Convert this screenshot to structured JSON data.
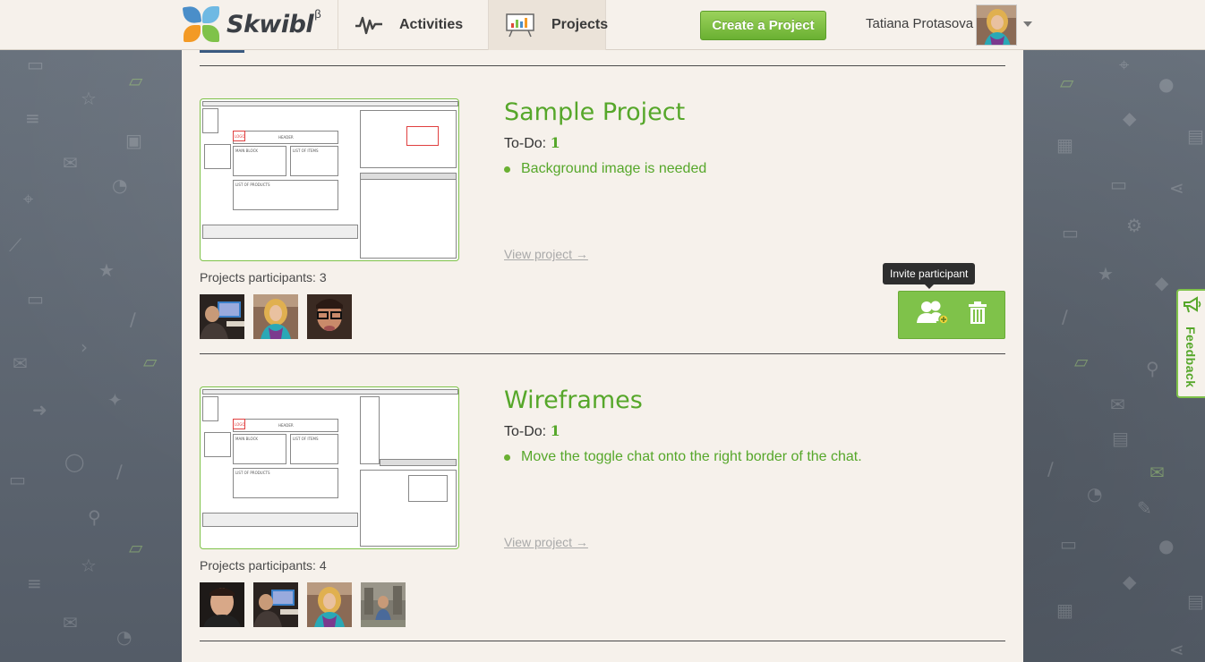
{
  "header": {
    "logo_text": "Skwibl",
    "logo_beta": "β",
    "nav": [
      {
        "label": "Activities",
        "icon": "activity-wave-icon"
      },
      {
        "label": "Projects",
        "icon": "presentation-board-icon"
      }
    ],
    "create_button": "Create a Project",
    "user_name": "Tatiana Protasova"
  },
  "projects": [
    {
      "title": "Sample Project",
      "todo_label": "To-Do:",
      "todo_count": "1",
      "todo_items": [
        "Background image is needed"
      ],
      "view_link": "View project →",
      "participants_label": "Projects participants:",
      "participants_count": "3",
      "thumb_labels": {
        "header": "HEADER",
        "logo": "LOGO",
        "main_block": "MAIN BLOCK",
        "list_items": "LIST OF ITEMS",
        "list_products": "LIST OF PRODUCTS"
      }
    },
    {
      "title": "Wireframes",
      "todo_label": "To-Do:",
      "todo_count": "1",
      "todo_items": [
        "Move the toggle chat onto the right border of the chat."
      ],
      "view_link": "View project →",
      "participants_label": "Projects participants:",
      "participants_count": "4",
      "thumb_labels": {
        "header": "HEADER",
        "logo": "LOGO",
        "main_block": "MAIN BLOCK",
        "list_items": "LIST OF ITEMS",
        "list_products": "LIST OF PRODUCTS"
      }
    }
  ],
  "tooltip": "Invite participant",
  "feedback": "Feedback",
  "colors": {
    "accent": "#56a72a",
    "button_green": "#7fc24a",
    "panel": "#f6f1eb",
    "background": "#5b6470"
  }
}
